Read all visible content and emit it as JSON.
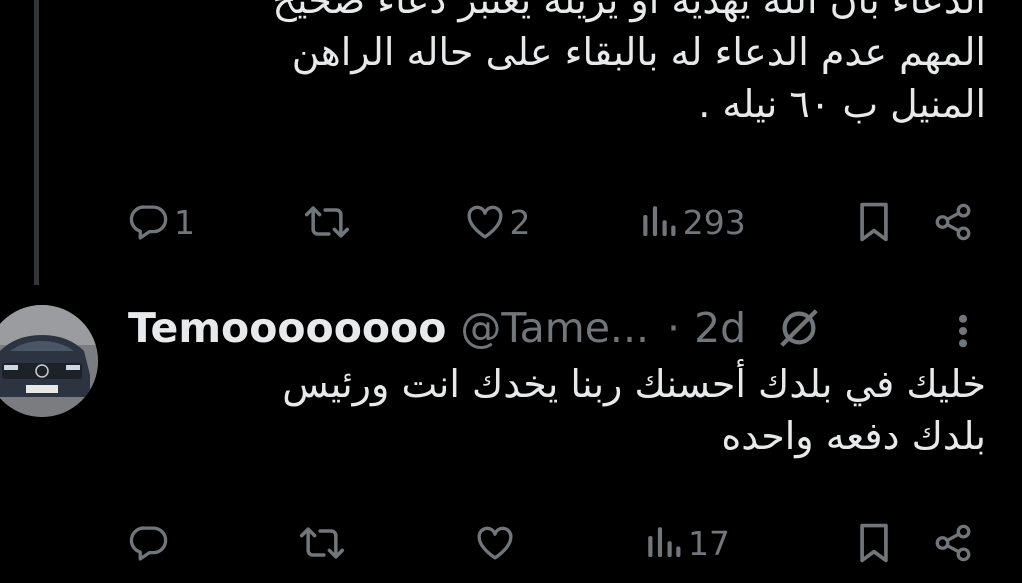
{
  "thread_line": true,
  "tweets": [
    {
      "text_lines": [
        "الدعاء بأن الله يهديه أو يريله يعتبر دعاء صحيح",
        "المهم عدم الدعاء له بالبقاء على حاله الراهن",
        "المنيل ب ٦٠ نيله ."
      ],
      "actions": {
        "reply_count": "1",
        "retweet_count": "",
        "like_count": "2",
        "view_count": "293"
      }
    },
    {
      "author": {
        "display_name": "Temoooooooo",
        "handle": "@Tame...",
        "separator": "·",
        "time": "2d",
        "avatar_icon": "car-avatar"
      },
      "text_lines": [
        "خليك في بلدك أحسنك ربنا يخدك انت ورئيس",
        "بلدك دفعه واحده"
      ],
      "actions": {
        "reply_count": "",
        "retweet_count": "",
        "like_count": "",
        "view_count": "17"
      }
    }
  ],
  "colors": {
    "background": "#000000",
    "text": "#e7e9ea",
    "muted": "#71767b",
    "thread_line": "#333639"
  }
}
